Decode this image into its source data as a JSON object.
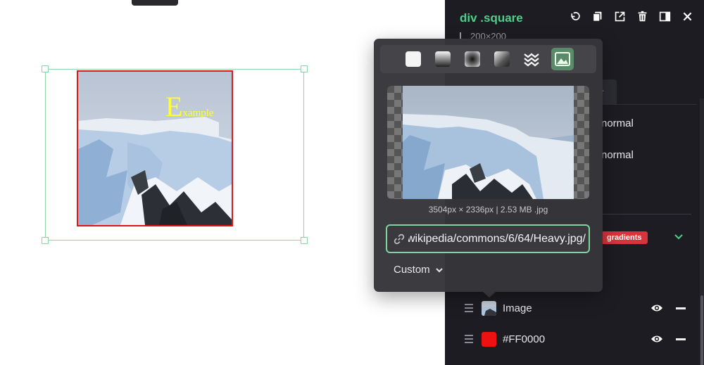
{
  "canvas": {
    "element_text_big": "E",
    "element_text_small": "xample"
  },
  "panel": {
    "title": "div .square",
    "dimensions": "200×200",
    "toolbar": [
      "undo-icon",
      "copy-icon",
      "external-link-icon",
      "trash-icon",
      "sidebar-toggle-icon",
      "close-icon"
    ],
    "tab_fragment": "r",
    "blend_modes": [
      "normal",
      "normal"
    ],
    "badge": "gradients",
    "layers": [
      {
        "label": "Image",
        "type": "image"
      },
      {
        "label": "#FF0000",
        "type": "color",
        "color": "#FF0000"
      }
    ]
  },
  "popover": {
    "types": [
      "solid",
      "linear-gradient",
      "radial-gradient",
      "conic-gradient",
      "pattern",
      "image"
    ],
    "active_type": "image",
    "image_meta": "3504px × 2336px | 2.53 MB .jpg",
    "url": "/wikipedia/commons/6/64/Heavy.jpg",
    "mode": "Custom"
  },
  "colors": {
    "accent": "#4fd08a",
    "panel_bg": "#1c1c22",
    "badge": "#d9343b",
    "border_red": "#e01818"
  }
}
